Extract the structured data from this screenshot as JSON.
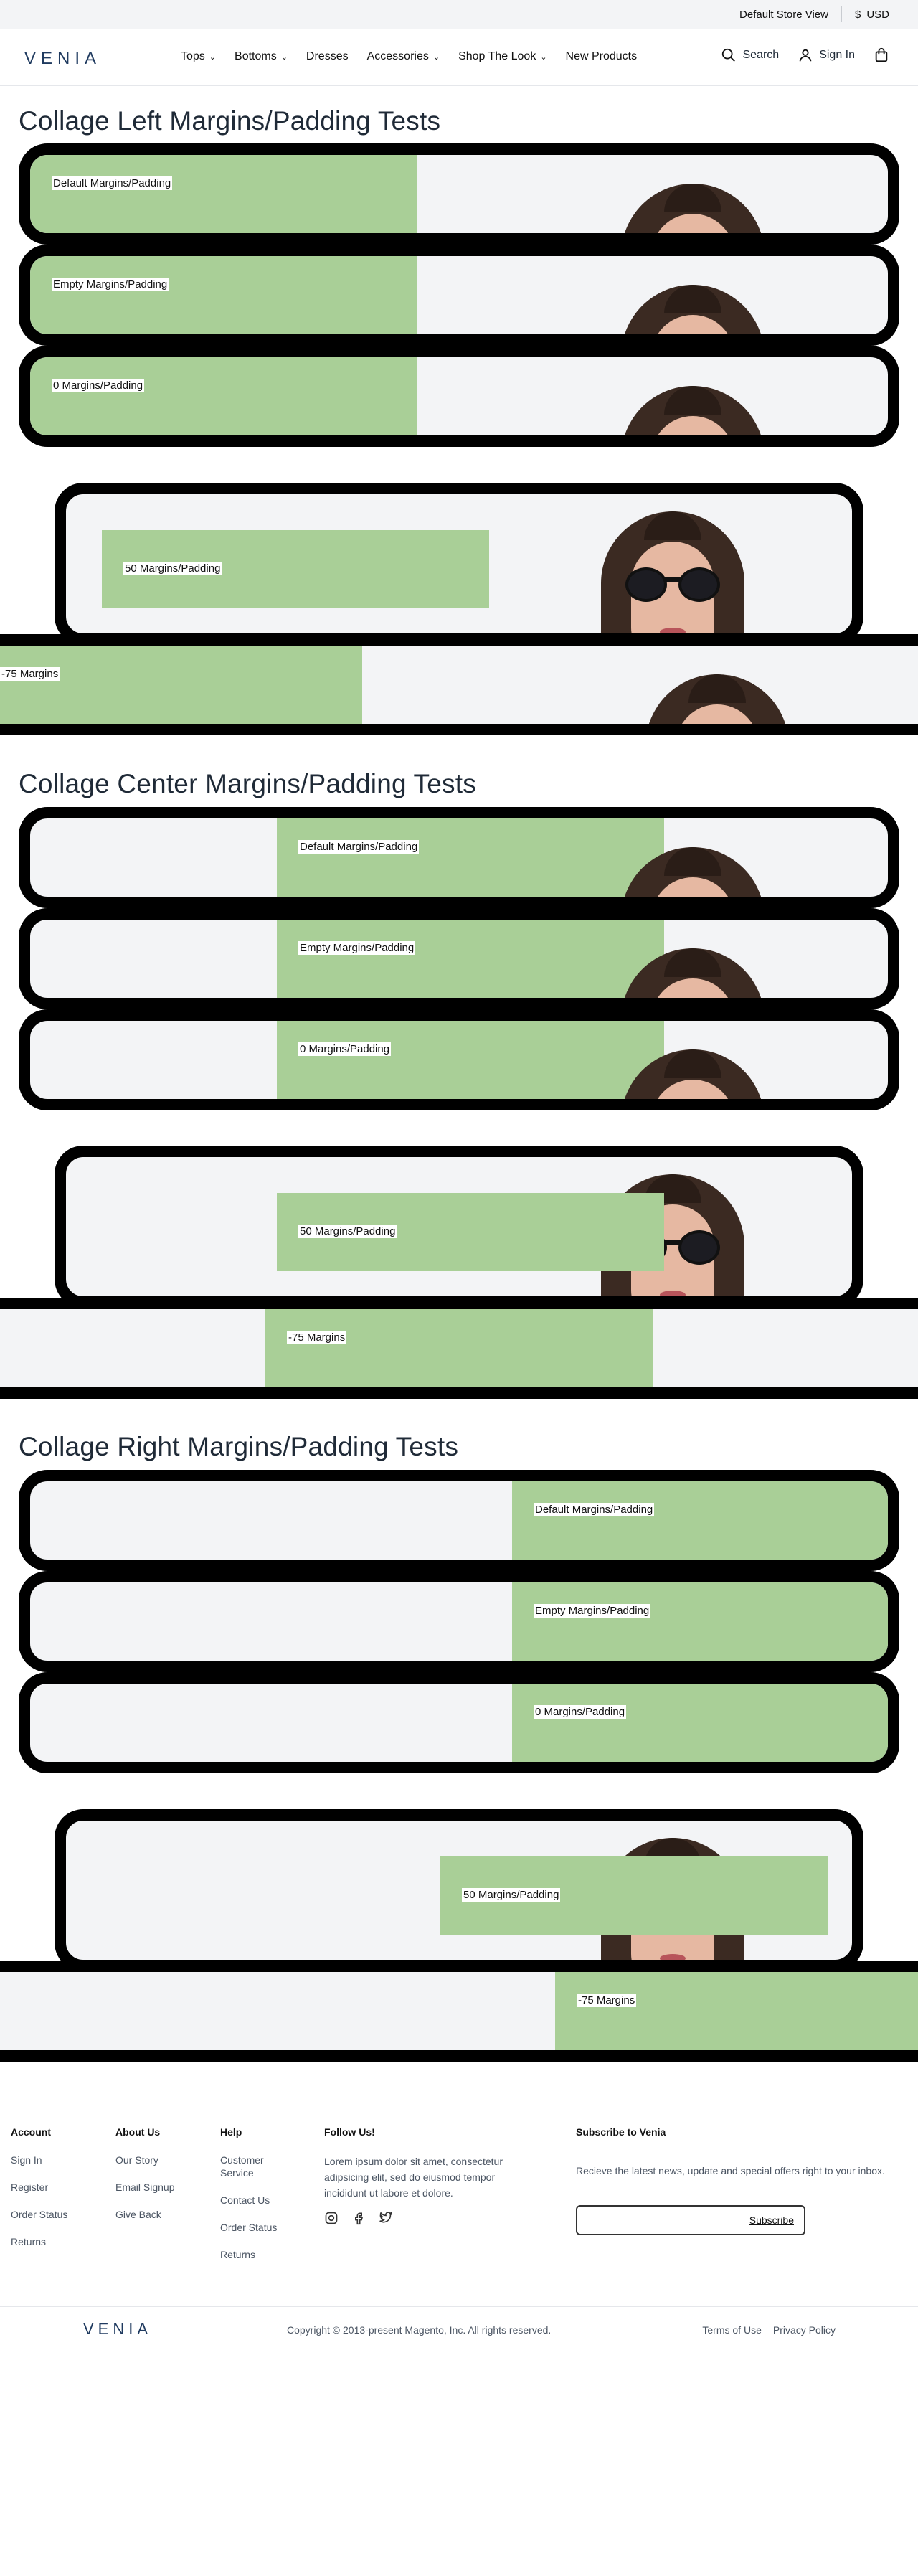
{
  "topbar": {
    "store_view": "Default Store View",
    "currency_symbol": "$",
    "currency": "USD"
  },
  "header": {
    "logo": "VENIA",
    "nav": [
      {
        "label": "Tops",
        "has_menu": true
      },
      {
        "label": "Bottoms",
        "has_menu": true
      },
      {
        "label": "Dresses",
        "has_menu": false
      },
      {
        "label": "Accessories",
        "has_menu": true
      },
      {
        "label": "Shop The Look",
        "has_menu": true
      },
      {
        "label": "New Products",
        "has_menu": false
      }
    ],
    "search_label": "Search",
    "signin_label": "Sign In"
  },
  "sections": {
    "left": {
      "title": "Collage Left Margins/Padding Tests",
      "labels": [
        "Default Margins/Padding",
        "Empty Margins/Padding",
        "0 Margins/Padding",
        "50 Margins/Padding",
        "-75 Margins"
      ]
    },
    "center": {
      "title": "Collage Center Margins/Padding Tests",
      "labels": [
        "Default Margins/Padding",
        "Empty Margins/Padding",
        "0 Margins/Padding",
        "50 Margins/Padding",
        "-75 Margins"
      ]
    },
    "right": {
      "title": "Collage Right Margins/Padding Tests",
      "labels": [
        "Default Margins/Padding",
        "Empty Margins/Padding",
        "0 Margins/Padding",
        "50 Margins/Padding",
        "-75 Margins"
      ]
    }
  },
  "footer": {
    "account": {
      "title": "Account",
      "links": [
        "Sign In",
        "Register",
        "Order Status",
        "Returns"
      ]
    },
    "about": {
      "title": "About Us",
      "links": [
        "Our Story",
        "Email Signup",
        "Give Back"
      ]
    },
    "help": {
      "title": "Help",
      "links": [
        "Customer Service",
        "Contact Us",
        "Order Status",
        "Returns"
      ]
    },
    "follow": {
      "title": "Follow Us!",
      "text": "Lorem ipsum dolor sit amet, consectetur adipsicing elit, sed do eiusmod tempor incididunt ut labore et dolore."
    },
    "subscribe": {
      "title": "Subscribe to Venia",
      "text": "Recieve the latest news, update and special offers right to your inbox.",
      "button": "Subscribe"
    },
    "logo": "VENIA",
    "copyright": "Copyright © 2013-present Magento, Inc. All rights reserved.",
    "legal": [
      "Terms of Use",
      "Privacy Policy"
    ]
  },
  "colors": {
    "banner_bg": "#f3f4f6",
    "content_green": "#a9cf97",
    "border": "#000000"
  }
}
